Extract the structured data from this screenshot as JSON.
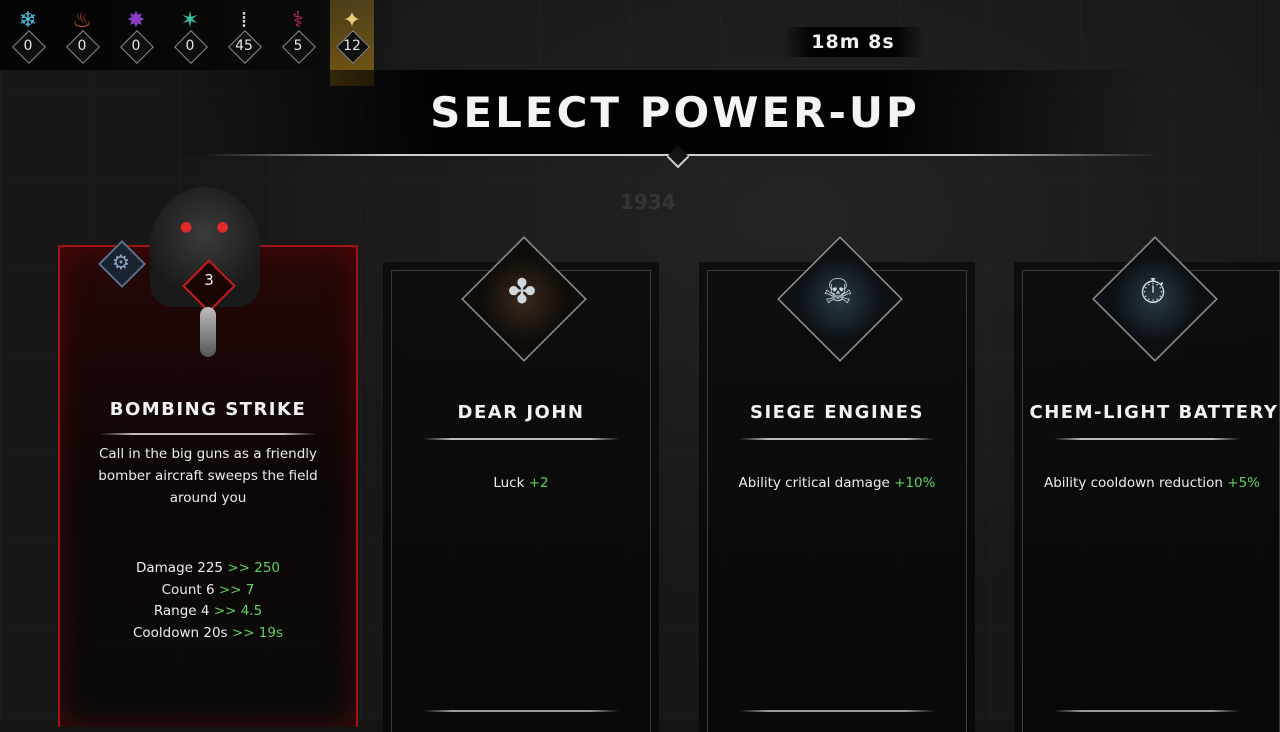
{
  "resources": [
    {
      "icon": "frost-icon",
      "glyph": "❄",
      "count": "0",
      "color": "#4fc3e8"
    },
    {
      "icon": "fire-icon",
      "glyph": "♨",
      "count": "0",
      "color": "#d0502a"
    },
    {
      "icon": "void-icon",
      "glyph": "✸",
      "count": "0",
      "color": "#8a3dc2"
    },
    {
      "icon": "toxic-icon",
      "glyph": "✶",
      "count": "0",
      "color": "#37c2a7"
    },
    {
      "icon": "bullet-icon",
      "glyph": "⁞",
      "count": "45",
      "color": "#cfcfcf"
    },
    {
      "icon": "blood-icon",
      "glyph": "⚕",
      "count": "5",
      "color": "#c42f58"
    },
    {
      "icon": "spark-icon",
      "glyph": "✦",
      "count": "12",
      "color": "#e8d07a"
    }
  ],
  "timer": "18m 8s",
  "title": "SELECT POWER-UP",
  "background_number": "1934",
  "cards": [
    {
      "name": "BOMBING STRIKE",
      "level": "3",
      "description": "Call in the big guns as a friendly bomber aircraft sweeps the field around you",
      "stats": [
        {
          "label": "Damage 225",
          "change": ">> 250"
        },
        {
          "label": "Count 6",
          "change": ">> 7"
        },
        {
          "label": "Range 4",
          "change": ">> 4.5"
        },
        {
          "label": "Cooldown 20s",
          "change": ">> 19s"
        }
      ]
    },
    {
      "name": "DEAR JOHN",
      "effect": "Luck",
      "value": "+2"
    },
    {
      "name": "SIEGE ENGINES",
      "effect": "Ability critical damage",
      "value": "+10%"
    },
    {
      "name": "CHEM-LIGHT BATTERY",
      "effect": "Ability cooldown reduction",
      "value": "+5%"
    }
  ]
}
